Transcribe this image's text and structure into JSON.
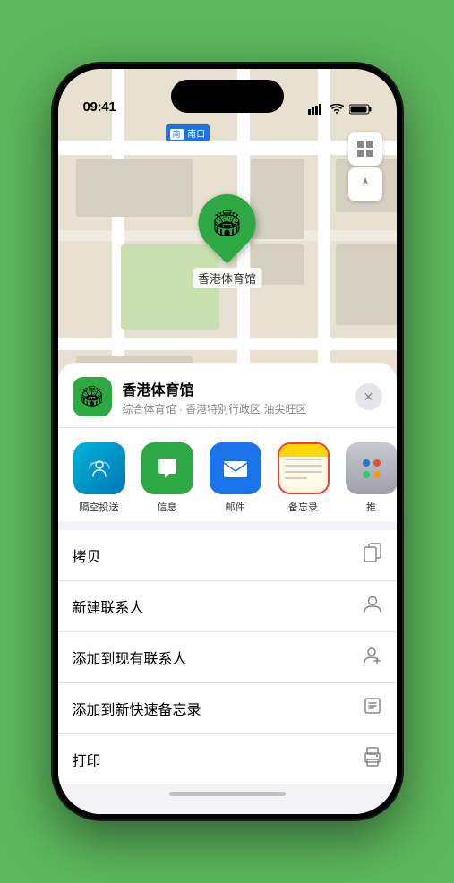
{
  "status_bar": {
    "time": "09:41",
    "signal": "▌▌▌",
    "wifi": "WiFi",
    "battery": "Battery"
  },
  "map": {
    "south_entrance_label": "南口",
    "south_entrance_prefix": "南",
    "venue_label": "香港体育馆"
  },
  "sheet": {
    "venue_name": "香港体育馆",
    "venue_sub": "综合体育馆 · 香港特别行政区 油尖旺区",
    "close_label": "✕"
  },
  "share_items": [
    {
      "id": "airdrop",
      "label": "隔空投送"
    },
    {
      "id": "messages",
      "label": "信息"
    },
    {
      "id": "mail",
      "label": "邮件"
    },
    {
      "id": "notes",
      "label": "备忘录"
    },
    {
      "id": "more",
      "label": "推"
    }
  ],
  "actions": [
    {
      "label": "拷贝",
      "icon": "📋"
    },
    {
      "label": "新建联系人",
      "icon": "👤"
    },
    {
      "label": "添加到现有联系人",
      "icon": "👤"
    },
    {
      "label": "添加到新快速备忘录",
      "icon": "📝"
    },
    {
      "label": "打印",
      "icon": "🖨"
    }
  ]
}
